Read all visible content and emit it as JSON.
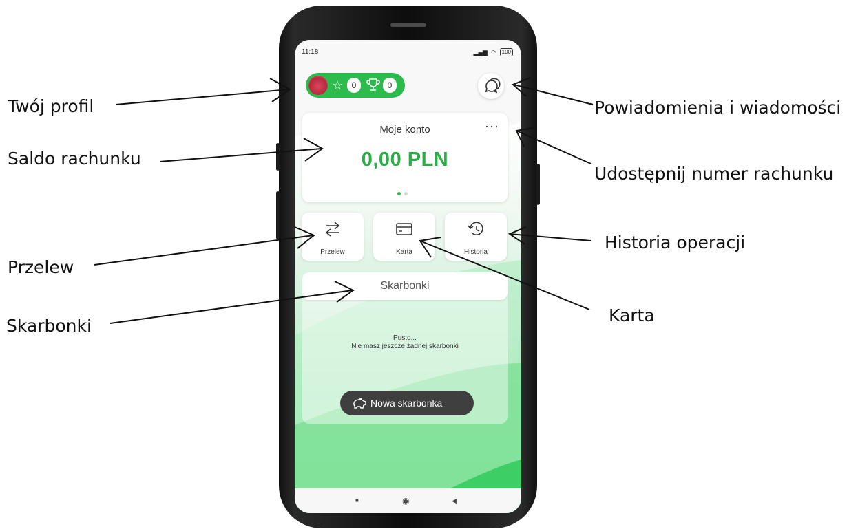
{
  "callouts": {
    "profile": "Twój profil",
    "balance": "Saldo rachunku",
    "transfer": "Przelew",
    "piggy_banks": "Skarbonki",
    "notifications": "Powiadomienia i wiadomości",
    "share_account": "Udostępnij numer rachunku",
    "history": "Historia operacji",
    "card": "Karta"
  },
  "status_bar": {
    "time": "11:18",
    "battery": "100"
  },
  "profile": {
    "stars_count": "0",
    "trophies_count": "0"
  },
  "account": {
    "title": "Moje konto",
    "more_label": "···",
    "balance": "0,00 PLN",
    "pager_total": 2,
    "pager_active": 0
  },
  "actions": [
    {
      "label": "Przelew",
      "icon": "transfer-arrows-icon"
    },
    {
      "label": "Karta",
      "icon": "card-icon"
    },
    {
      "label": "Historia",
      "icon": "history-clock-icon"
    }
  ],
  "piggy_banks": {
    "title": "Skarbonki",
    "empty_title": "Pusto...",
    "empty_subtitle": "Nie masz jeszcze żadnej skarbonki",
    "new_button": "Nowa skarbonka"
  },
  "nav": {
    "recent": "■",
    "home": "◉",
    "back": "◀"
  },
  "colors": {
    "brand_green": "#2dbb4e",
    "balance_green": "#2cae46",
    "dark_button": "#3f3f3f"
  }
}
